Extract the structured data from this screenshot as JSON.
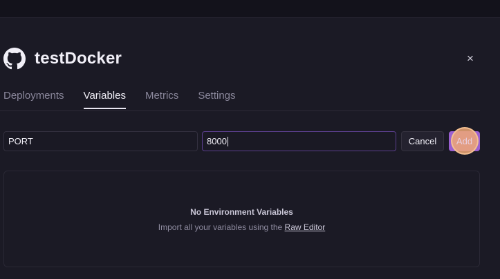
{
  "project": {
    "title": "testDocker",
    "icon": "github-icon"
  },
  "close": {
    "label": "×",
    "icon": "close-icon"
  },
  "tabs": [
    {
      "label": "Deployments",
      "active": false
    },
    {
      "label": "Variables",
      "active": true
    },
    {
      "label": "Metrics",
      "active": false
    },
    {
      "label": "Settings",
      "active": false
    }
  ],
  "new_variable": {
    "key_value": "PORT",
    "value_value": "8000"
  },
  "buttons": {
    "cancel_label": "Cancel",
    "add_label": "Add"
  },
  "empty_state": {
    "title": "No Environment Variables",
    "subtitle_prefix": "Import all your variables using the ",
    "link_label": "Raw Editor"
  },
  "colors": {
    "background": "#1b1a25",
    "accent": "#9a5fd0",
    "active_input_border": "#5b3f8e"
  }
}
